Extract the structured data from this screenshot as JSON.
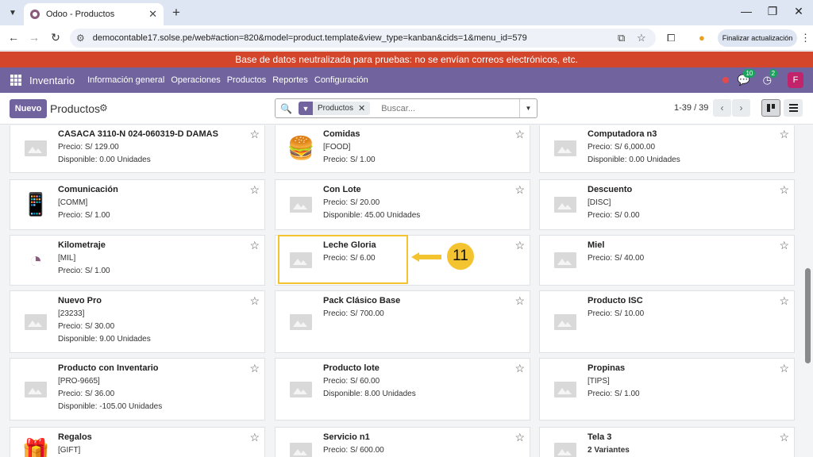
{
  "browser": {
    "tab_title": "Odoo - Productos",
    "url": "democontable17.solse.pe/web#action=820&model=product.template&view_type=kanban&cids=1&menu_id=579",
    "update_button": "Finalizar actualización"
  },
  "banner": {
    "text": "Base de datos neutralizada para pruebas: no se envían correos electrónicos, etc."
  },
  "navbar": {
    "app": "Inventario",
    "menu": [
      "Información general",
      "Operaciones",
      "Productos",
      "Reportes",
      "Configuración"
    ],
    "messages_count": "10",
    "activities_count": "2",
    "avatar_letter": "F"
  },
  "control": {
    "new_button": "Nuevo",
    "breadcrumb": "Productos",
    "facet_label": "Productos",
    "search_placeholder": "Buscar...",
    "pager": "1-39 / 39"
  },
  "products": [
    {
      "name": "CASACA 3110-N 024-060319-D DAMAS",
      "lines": [
        "Precio: S/ 129.00",
        "Disponible: 0.00 Unidades"
      ],
      "icon": "image-placeholder-icon"
    },
    {
      "name": "Comidas",
      "lines": [
        "[FOOD]",
        "Precio: S/ 1.00"
      ],
      "icon": "food-icon"
    },
    {
      "name": "Computadora n3",
      "lines": [
        "Precio: S/ 6,000.00",
        "Disponible: 0.00 Unidades"
      ],
      "icon": "image-placeholder-icon"
    },
    {
      "name": "Comunicación",
      "lines": [
        "[COMM]",
        "Precio: S/ 1.00"
      ],
      "icon": "phone-dollar-icon"
    },
    {
      "name": "Con Lote",
      "lines": [
        "Precio: S/ 20.00",
        "Disponible: 45.00 Unidades"
      ],
      "icon": "image-placeholder-icon"
    },
    {
      "name": "Descuento",
      "lines": [
        "[DISC]",
        "Precio: S/ 0.00"
      ],
      "icon": "image-placeholder-icon"
    },
    {
      "name": "Kilometraje",
      "lines": [
        "[MIL]",
        "Precio: S/ 1.00"
      ],
      "icon": "gauge-icon"
    },
    {
      "name": "Leche Gloria",
      "lines": [
        "Precio: S/ 6.00"
      ],
      "icon": "image-placeholder-icon"
    },
    {
      "name": "Miel",
      "lines": [
        "Precio: S/ 40.00"
      ],
      "icon": "image-placeholder-icon"
    },
    {
      "name": "Nuevo Pro",
      "lines": [
        "[23233]",
        "Precio: S/ 30.00",
        "Disponible: 9.00 Unidades"
      ],
      "icon": "image-placeholder-icon"
    },
    {
      "name": "Pack Clásico Base",
      "lines": [
        "Precio: S/ 700.00"
      ],
      "icon": "image-placeholder-icon"
    },
    {
      "name": "Producto ISC",
      "lines": [
        "Precio: S/ 10.00"
      ],
      "icon": "image-placeholder-icon"
    },
    {
      "name": "Producto con Inventario",
      "lines": [
        "[PRO-9665]",
        "Precio: S/ 36.00",
        "Disponible: -105.00 Unidades"
      ],
      "icon": "image-placeholder-icon"
    },
    {
      "name": "Producto lote",
      "lines": [
        "Precio: S/ 60.00",
        "Disponible: 8.00 Unidades"
      ],
      "icon": "image-placeholder-icon"
    },
    {
      "name": "Propinas",
      "lines": [
        "[TIPS]",
        "Precio: S/ 1.00"
      ],
      "icon": "image-placeholder-icon"
    },
    {
      "name": "Regalos",
      "lines": [
        "[GIFT]"
      ],
      "icon": "gift-icon"
    },
    {
      "name": "Servicio n1",
      "lines": [
        "Precio: S/ 600.00"
      ],
      "icon": "image-placeholder-icon"
    },
    {
      "name": "Tela 3",
      "lines": [
        "2 Variantes"
      ],
      "icon": "image-placeholder-icon"
    }
  ],
  "annotation": {
    "step": "11",
    "color": "#f4c430"
  }
}
